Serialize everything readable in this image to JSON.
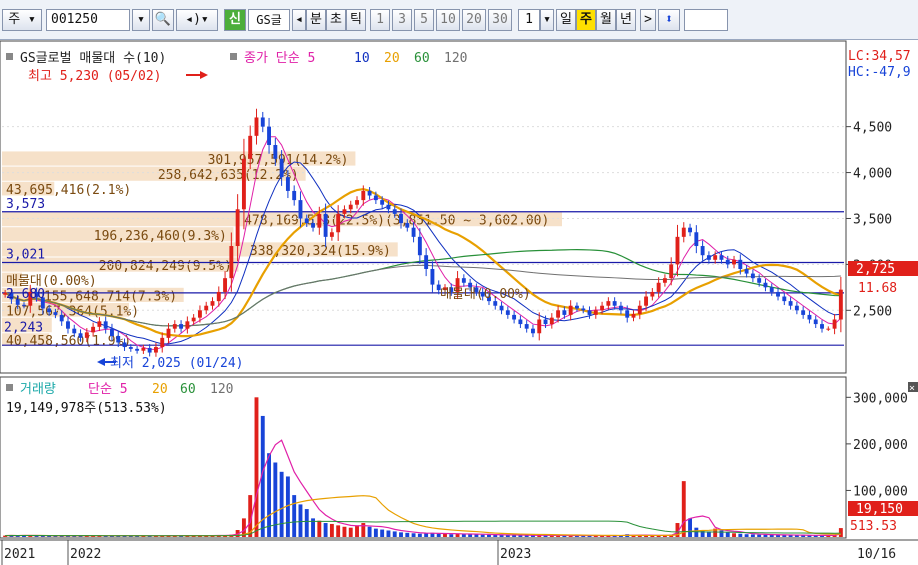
{
  "toolbar": {
    "market": "주",
    "code": "001250",
    "new_label": "신",
    "stock_name": "GS글",
    "prev_label": "◂",
    "minute_label": "분",
    "second_label": "초",
    "tick_label": "틱",
    "interval_1": "1",
    "interval_3": "3",
    "interval_5": "5",
    "interval_10": "10",
    "interval_20": "20",
    "interval_30": "30",
    "period_num": "1",
    "day_label": "일",
    "week_label": "주",
    "month_label": "월",
    "year_label": "년",
    "next_label": ">",
    "updown_label": "⬍"
  },
  "price_legend": {
    "title": "GS글로벌 매물대 수(10)",
    "close_label": "종가 단순 5",
    "ma10": "10",
    "ma20": "20",
    "ma60": "60",
    "ma120": "120"
  },
  "volume_legend": {
    "title": "거래량",
    "ma_label": "단순 5",
    "ma20": "20",
    "ma60": "60",
    "ma120": "120",
    "current": "19,149,978주(513.53%)"
  },
  "right_info": {
    "lc": "LC:34,57",
    "hc": "HC:-47,9",
    "price_tag": "2,725",
    "pct_tag": "11.68",
    "vol_tag": "19,150",
    "vol_pct_tag": "513.53"
  },
  "annotations": {
    "high": "최고 5,230 (05/02)",
    "low": "최저 2,025 (01/24)"
  },
  "colors": {
    "up": "#e0201a",
    "down": "#1844d8",
    "ma5": "#e020a8",
    "ma10": "#1030c0",
    "ma20": "#e8a000",
    "ma60": "#289038",
    "ma120": "#707070",
    "hline": "#1a1aa8",
    "profile": "#f5dcc0"
  },
  "chart_data": {
    "type": "candlestick",
    "interval": "weekly",
    "x_labels": [
      "2021",
      "2022",
      "2023",
      "10/16"
    ],
    "y_ticks": [
      2500,
      3000,
      3500,
      4000,
      4500
    ],
    "y_ticks_text": [
      "2,500",
      "3,000",
      "3,500",
      "4,000",
      "4,500"
    ],
    "ylim": [
      1850,
      5400
    ],
    "vol_ticks": [
      100000,
      200000,
      300000
    ],
    "vol_ticks_text": [
      "100,000",
      "200,000",
      "300,000"
    ],
    "vol_unit": "천주",
    "horizontal_levels": [
      {
        "price": 3573,
        "label": "3,573"
      },
      {
        "price": 3021,
        "label": "3,021"
      },
      {
        "price": 2690,
        "label": ""
      },
      {
        "price": 2120,
        "label": ""
      }
    ],
    "volume_profile": [
      {
        "price_low": 2100,
        "price_high": 2250,
        "label": "40,458,560(1.9%)"
      },
      {
        "price_low": 2250,
        "price_high": 2420,
        "label": ""
      },
      {
        "price_low": 2420,
        "price_high": 2580,
        "label": "107,567,364(5.1%)"
      },
      {
        "price_low": 2580,
        "price_high": 2745,
        "label": "155,648,714(7.3%)"
      },
      {
        "price_low": 2745,
        "price_high": 2910,
        "label": "매물대(0.00%)"
      },
      {
        "price_low": 2910,
        "price_high": 3075,
        "label": "200,824,249(9.5%)"
      },
      {
        "price_low": 3075,
        "price_high": 3240,
        "label": "338,320,324(15.9%)"
      },
      {
        "price_low": 3240,
        "price_high": 3405,
        "label": "196,236,460(9.3%)"
      },
      {
        "price_low": 3405,
        "price_high": 3570,
        "label": "478,169,513(22.5%)(3,851.50 ~ 3,602.00)"
      },
      {
        "price_low": 3740,
        "price_high": 3900,
        "label": "43,695,416(2.1%)"
      },
      {
        "price_low": 3900,
        "price_high": 4065,
        "label": "258,642,635(12.2%)"
      },
      {
        "price_low": 4065,
        "price_high": 4230,
        "label": "301,957,591(14.2%)"
      }
    ],
    "profile_extra_labels": [
      "2,680",
      "매물대(0.00%)",
      "2,243"
    ],
    "closes": [
      2690,
      2620,
      2560,
      2550,
      2700,
      2640,
      2520,
      2480,
      2450,
      2380,
      2300,
      2250,
      2200,
      2260,
      2320,
      2380,
      2300,
      2220,
      2150,
      2100,
      2080,
      2060,
      2090,
      2040,
      2100,
      2200,
      2300,
      2350,
      2300,
      2380,
      2420,
      2500,
      2550,
      2600,
      2700,
      2850,
      3200,
      3600,
      4150,
      4400,
      4600,
      4500,
      4300,
      4150,
      3950,
      3800,
      3700,
      3500,
      3450,
      3400,
      3550,
      3300,
      3350,
      3550,
      3600,
      3650,
      3700,
      3800,
      3750,
      3700,
      3650,
      3600,
      3550,
      3450,
      3400,
      3300,
      3100,
      2950,
      2780,
      2720,
      2750,
      2700,
      2850,
      2800,
      2750,
      2700,
      2650,
      2600,
      2550,
      2500,
      2450,
      2400,
      2350,
      2300,
      2250,
      2400,
      2350,
      2420,
      2500,
      2450,
      2550,
      2520,
      2500,
      2450,
      2500,
      2550,
      2600,
      2550,
      2500,
      2420,
      2460,
      2550,
      2650,
      2700,
      2800,
      2850,
      3000,
      3300,
      3400,
      3350,
      3200,
      3100,
      3050,
      3100,
      3050,
      3000,
      3050,
      2950,
      2900,
      2850,
      2800,
      2750,
      2700,
      2650,
      2600,
      2550,
      2500,
      2450,
      2400,
      2350,
      2300,
      2300,
      2400,
      2725
    ],
    "volumes": [
      3000,
      3500,
      2800,
      4000,
      3200,
      2500,
      3000,
      2600,
      2400,
      3100,
      2700,
      2300,
      2500,
      2600,
      2400,
      2800,
      2200,
      2400,
      2300,
      3500,
      2500,
      2200,
      2400,
      2300,
      2700,
      3000,
      2900,
      2600,
      3100,
      2800,
      3200,
      3000,
      2700,
      3300,
      3800,
      4200,
      5000,
      15000,
      40000,
      90000,
      300000,
      260000,
      180000,
      160000,
      140000,
      130000,
      90000,
      70000,
      60000,
      40000,
      35000,
      30000,
      28000,
      25000,
      22000,
      20000,
      25000,
      30000,
      22000,
      18000,
      16000,
      14000,
      12000,
      10000,
      9000,
      8000,
      7000,
      8000,
      9000,
      7000,
      6500,
      6000,
      7000,
      6500,
      6000,
      5500,
      5000,
      4800,
      4600,
      4400,
      4200,
      4000,
      3800,
      3600,
      3400,
      3600,
      3500,
      3400,
      3300,
      3200,
      3100,
      3000,
      3200,
      3100,
      3000,
      2900,
      2800,
      3000,
      3500,
      6000,
      4000,
      3500,
      3000,
      3200,
      3500,
      4000,
      5000,
      30000,
      120000,
      40000,
      20000,
      15000,
      12000,
      18000,
      14000,
      10000,
      8000,
      7000,
      6000,
      5500,
      5000,
      4800,
      4600,
      4400,
      4200,
      4000,
      3800,
      3600,
      3500,
      3400,
      3300,
      3500,
      4000,
      19150
    ]
  }
}
